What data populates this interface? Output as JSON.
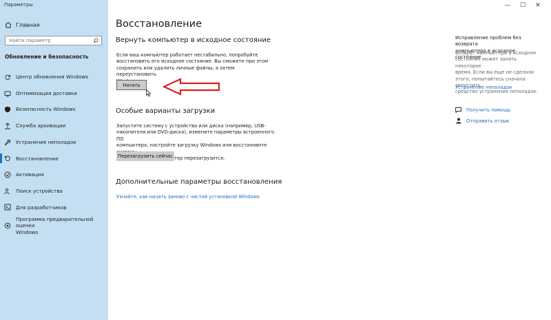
{
  "window": {
    "title": "Параметры",
    "minimize": "—",
    "maximize": "☐",
    "close": "✕"
  },
  "sidebar": {
    "home_label": "Главная",
    "search_placeholder": "Найти параметр",
    "section_title": "Обновление и безопасность",
    "items": [
      {
        "label": "Центр обновления Windows",
        "icon": "sync-icon"
      },
      {
        "label": "Оптимизация доставки",
        "icon": "delivery-icon"
      },
      {
        "label": "Безопасность Windows",
        "icon": "shield-icon"
      },
      {
        "label": "Служба архивации",
        "icon": "upload-icon"
      },
      {
        "label": "Устранение неполадок",
        "icon": "wrench-icon"
      },
      {
        "label": "Восстановление",
        "icon": "recovery-icon",
        "active": true
      },
      {
        "label": "Активация",
        "icon": "check-circle-icon"
      },
      {
        "label": "Поиск устройства",
        "icon": "person-search-icon"
      },
      {
        "label": "Для разработчиков",
        "icon": "developer-icon"
      },
      {
        "label_line1": "Программа предварительной оценки",
        "label_line2": "Windows",
        "icon": "insider-icon"
      }
    ]
  },
  "main": {
    "page_title": "Восстановление",
    "reset": {
      "heading": "Вернуть компьютер в исходное состояние",
      "description": [
        "Если ваш компьютер работает нестабильно, попробуйте",
        "восстановить его исходное состояние. Вы сможете при этом",
        "сохранить или удалить личные файлы, а затем переустановить",
        "Windows."
      ],
      "button": "Начать"
    },
    "advanced": {
      "heading": "Особые варианты загрузки",
      "description": [
        "Запустите систему с устройства или диска (например, USB-",
        "накопителя или DVD-диска), измените параметры встроенного ПО",
        "компьютера, настройте загрузку Windows или восстановите систему",
        "из образа. Ваш компьютер перезагрузится."
      ],
      "button": "Перезагрузить сейчас"
    },
    "more": {
      "heading": "Дополнительные параметры восстановления",
      "link": "Узнайте, как начать заново с чистой установкой Windows"
    }
  },
  "right": {
    "title": [
      "Исправление проблем без возврата",
      "компьютера в исходное состояние"
    ],
    "text": [
      "Возврат компьютера в исходное",
      "состояние может занять некоторое",
      "время. Если вы еще не сделали",
      "этого, попытайтесь сначала запустить",
      "средство устранения неполадок."
    ],
    "troubleshoot_link": "Устранение неполадок",
    "help_link": "Получить помощь",
    "feedback_link": "Отправить отзыв"
  },
  "colors": {
    "sidebar_bg": "#c4dff2",
    "accent": "#1a73c9",
    "link": "#1a6fbf",
    "button_bg": "#cccccc",
    "arrow": "#d9201f"
  }
}
